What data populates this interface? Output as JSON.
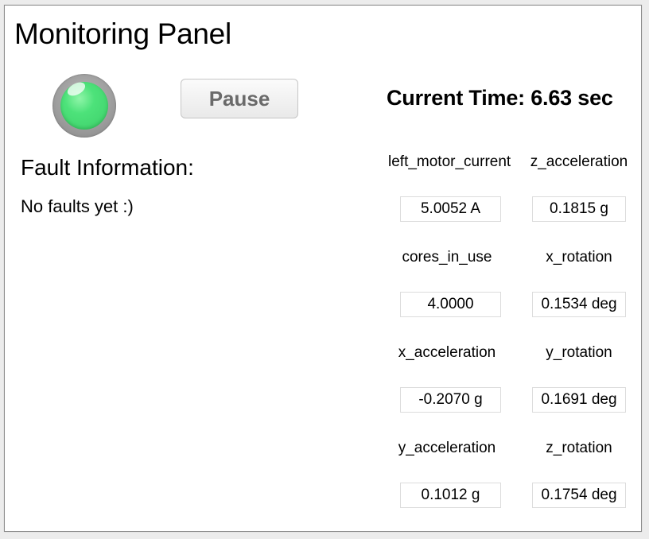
{
  "panel": {
    "title": "Monitoring Panel",
    "status_light": {
      "color": "#4de27a",
      "state": "ok"
    },
    "pause_label": "Pause",
    "current_time": "Current Time: 6.63 sec",
    "fault": {
      "heading": "Fault Information:",
      "message": "No faults yet :)"
    },
    "metrics": [
      {
        "label": "left_motor_current",
        "value": "5.0052 A"
      },
      {
        "label": "z_acceleration",
        "value": "0.1815 g"
      },
      {
        "label": "cores_in_use",
        "value": "4.0000"
      },
      {
        "label": "x_rotation",
        "value": "0.1534 deg"
      },
      {
        "label": "x_acceleration",
        "value": "-0.2070 g"
      },
      {
        "label": "y_rotation",
        "value": "0.1691 deg"
      },
      {
        "label": "y_acceleration",
        "value": "0.1012 g"
      },
      {
        "label": "z_rotation",
        "value": "0.1754 deg"
      }
    ]
  }
}
